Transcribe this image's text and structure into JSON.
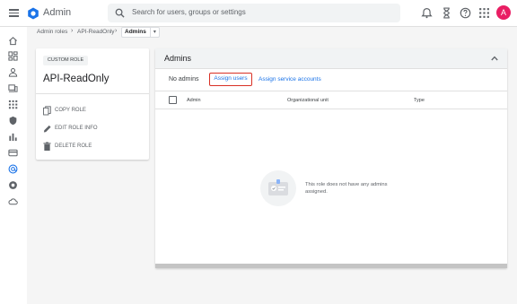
{
  "header": {
    "app_title": "Admin",
    "search_placeholder": "Search for users, groups or settings",
    "avatar_letter": "A",
    "icons": [
      "notifications-icon",
      "hourglass-icon",
      "help-icon",
      "apps-icon"
    ]
  },
  "rail": {
    "icons": [
      "home-icon",
      "dashboard-icon",
      "users-icon",
      "devices-icon",
      "apps-icon",
      "security-icon",
      "reports-icon",
      "billing-icon",
      "account-icon",
      "rules-icon",
      "storage-icon"
    ]
  },
  "breadcrumb": {
    "items": [
      "Admin roles",
      "API-ReadOnly"
    ],
    "current": "Admins"
  },
  "role": {
    "chip": "CUSTOM ROLE",
    "name": "API-ReadOnly",
    "actions": [
      {
        "label": "COPY ROLE",
        "icon": "copy-icon"
      },
      {
        "label": "EDIT ROLE INFO",
        "icon": "edit-icon"
      },
      {
        "label": "DELETE ROLE",
        "icon": "delete-icon"
      }
    ]
  },
  "admins": {
    "title": "Admins",
    "no_admins": "No admins",
    "assign_users": "Assign users",
    "assign_service_accounts": "Assign service accounts",
    "columns": [
      "Admin",
      "Organizational unit",
      "Type"
    ],
    "empty_message": "This role does not have any admins assigned."
  },
  "colors": {
    "accent": "#1a73e8",
    "highlight": "#d93025",
    "avatar": "#e91e63"
  }
}
